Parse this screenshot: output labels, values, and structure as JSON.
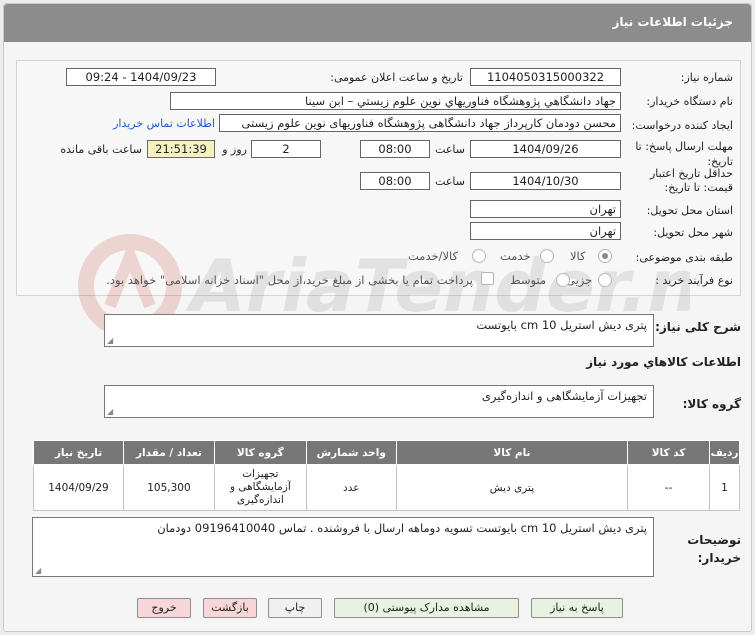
{
  "title": "جزئیات اطلاعات نیاز",
  "labels": {
    "need_number": "شماره نیاز:",
    "announce_datetime": "تاریخ و ساعت اعلان عمومی:",
    "buyer_org": "نام دستگاه خریدار:",
    "requester": "ایجاد کننده درخواست:",
    "response_deadline": "مهلت ارسال پاسخ: تا تاریخ:",
    "price_validity": "حداقل تاریخ اعتبار قیمت: تا تاریخ:",
    "time": "ساعت",
    "day_and": "روز و",
    "remaining": "ساعت باقی مانده",
    "province": "استان محل تحویل:",
    "city": "شهر محل تحویل:",
    "category": "طبقه بندی موضوعی:",
    "purchase_type": "نوع فرآیند خرید :"
  },
  "values": {
    "need_number": "1104050315000322",
    "announce_datetime": "1404/09/23 - 09:24",
    "buyer_org": "جهاد دانشگاهي پژوهشگاه فناوريهاي نوين علوم زيستي – ابن سينا",
    "requester": "محسن دودمان کارپرداز جهاد دانشگاهی پژوهشگاه فناوریهای نوین علوم زیستی",
    "contact_link": "اطلاعات تماس خریدار",
    "deadline_date": "1404/09/26",
    "deadline_time": "08:00",
    "days": "2",
    "remaining_time": "21:51:39",
    "validity_date": "1404/10/30",
    "validity_time": "08:00",
    "province": "تهران",
    "city": "تهران"
  },
  "category_options": [
    "کالا",
    "خدمت",
    "کالا/خدمت"
  ],
  "category_selected": "کالا",
  "purchase_options": [
    "جزیی",
    "متوسط"
  ],
  "purchase_note": "پرداخت تمام یا بخشی از مبلغ خرید،از محل \"اسناد خزانه اسلامی\" خواهد بود.",
  "summary_label": "شرح کلی نیاز:",
  "summary_text": "پتری دیش استریل 10 cm  بایوتست",
  "goods_info_title": "اطلاعات کالاهاي مورد نياز",
  "goods_group_label": "گروه کالا:",
  "goods_group_text": "تجهیزات آزمایشگاهی و اندازه‌گیری",
  "table": {
    "headers": [
      "ردیف",
      "کد کالا",
      "نام کالا",
      "واحد شمارش",
      "گروه کالا",
      "تعداد / مقدار",
      "تاریخ نیاز"
    ],
    "rows": [
      [
        "1",
        "--",
        "پتری دیش",
        "عدد",
        "تجهیزات آزمایشگاهی و اندازه‌گیری",
        "105,300",
        "1404/09/29"
      ]
    ]
  },
  "buyer_notes_label": "توضیحات خریدار:",
  "buyer_notes_text": "پتری دیش استریل 10 cm  بایوتست تسویه دوماهه ارسال با فروشنده . تماس 09196410040 دودمان",
  "buttons": {
    "reply": "پاسخ به نیاز",
    "attachments": "مشاهده مدارک پیوستی (0)",
    "print": "چاپ",
    "back": "بازگشت",
    "exit": "خروج"
  },
  "watermark": "AriaTender.net"
}
